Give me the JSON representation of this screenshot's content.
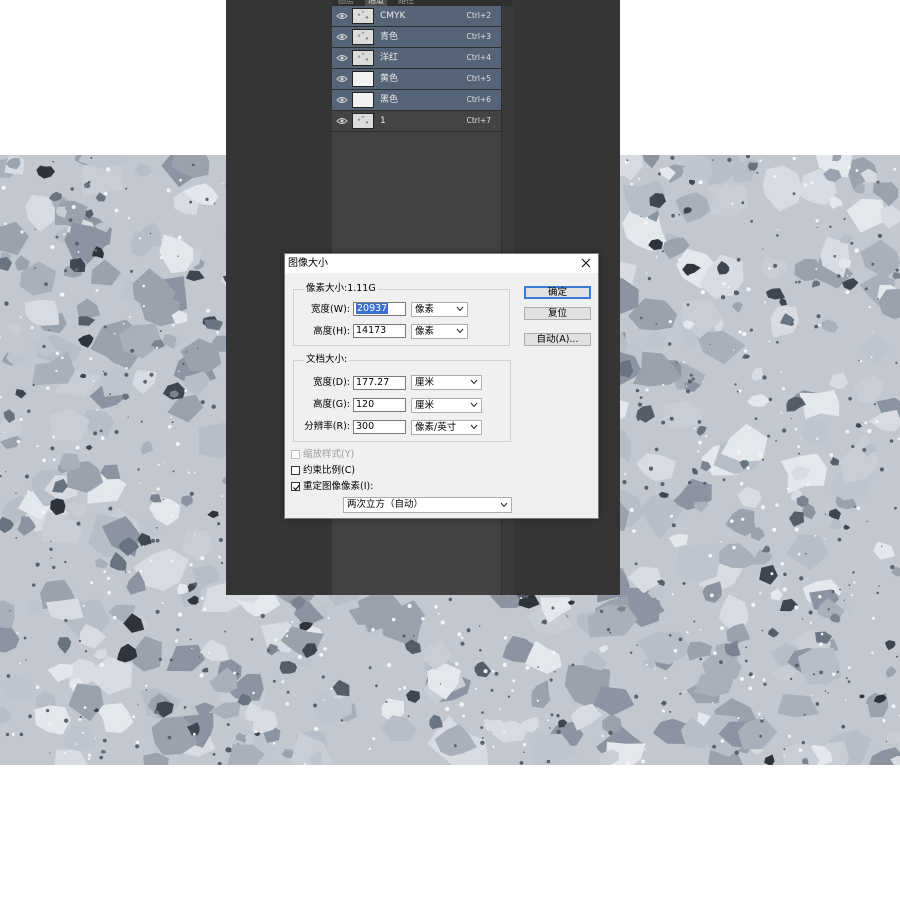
{
  "panel": {
    "tabs": [
      "图层",
      "通道",
      "路径"
    ],
    "channels": [
      {
        "name": "CMYK",
        "shortcut": "Ctrl+2",
        "selected": true,
        "thumb": "texture"
      },
      {
        "name": "青色",
        "shortcut": "Ctrl+3",
        "selected": true,
        "thumb": "texture"
      },
      {
        "name": "洋红",
        "shortcut": "Ctrl+4",
        "selected": true,
        "thumb": "texture"
      },
      {
        "name": "黄色",
        "shortcut": "Ctrl+5",
        "selected": true,
        "thumb": "white"
      },
      {
        "name": "黑色",
        "shortcut": "Ctrl+6",
        "selected": true,
        "thumb": "white"
      },
      {
        "name": "1",
        "shortcut": "Ctrl+7",
        "selected": false,
        "thumb": "texture"
      }
    ],
    "eye_icon": "eye-icon"
  },
  "dialog": {
    "title": "图像大小",
    "close_icon": "close-icon",
    "pixel_group": {
      "label": "像素大小:1.11G",
      "width_label": "宽度(W):",
      "width_value": "20937",
      "width_unit": "像素",
      "height_label": "高度(H):",
      "height_value": "14173",
      "height_unit": "像素"
    },
    "doc_group": {
      "label": "文档大小:",
      "width_label": "宽度(D):",
      "width_value": "177.27",
      "width_unit": "厘米",
      "height_label": "高度(G):",
      "height_value": "120",
      "height_unit": "厘米",
      "res_label": "分辨率(R):",
      "res_value": "300",
      "res_unit": "像素/英寸"
    },
    "buttons": {
      "ok": "确定",
      "reset": "复位",
      "auto": "自动(A)..."
    },
    "options": {
      "scale_styles": {
        "label": "缩放样式(Y)",
        "checked": false,
        "enabled": false
      },
      "constrain": {
        "label": "约束比例(C)",
        "checked": false,
        "enabled": true
      },
      "resample": {
        "label": "重定图像像素(I):",
        "checked": true,
        "enabled": true
      }
    },
    "resample_method": "两次立方（自动）"
  },
  "colors": {
    "panel_selected": "#566478",
    "dark_bg": "#353535",
    "accent": "#3b7ad8"
  }
}
